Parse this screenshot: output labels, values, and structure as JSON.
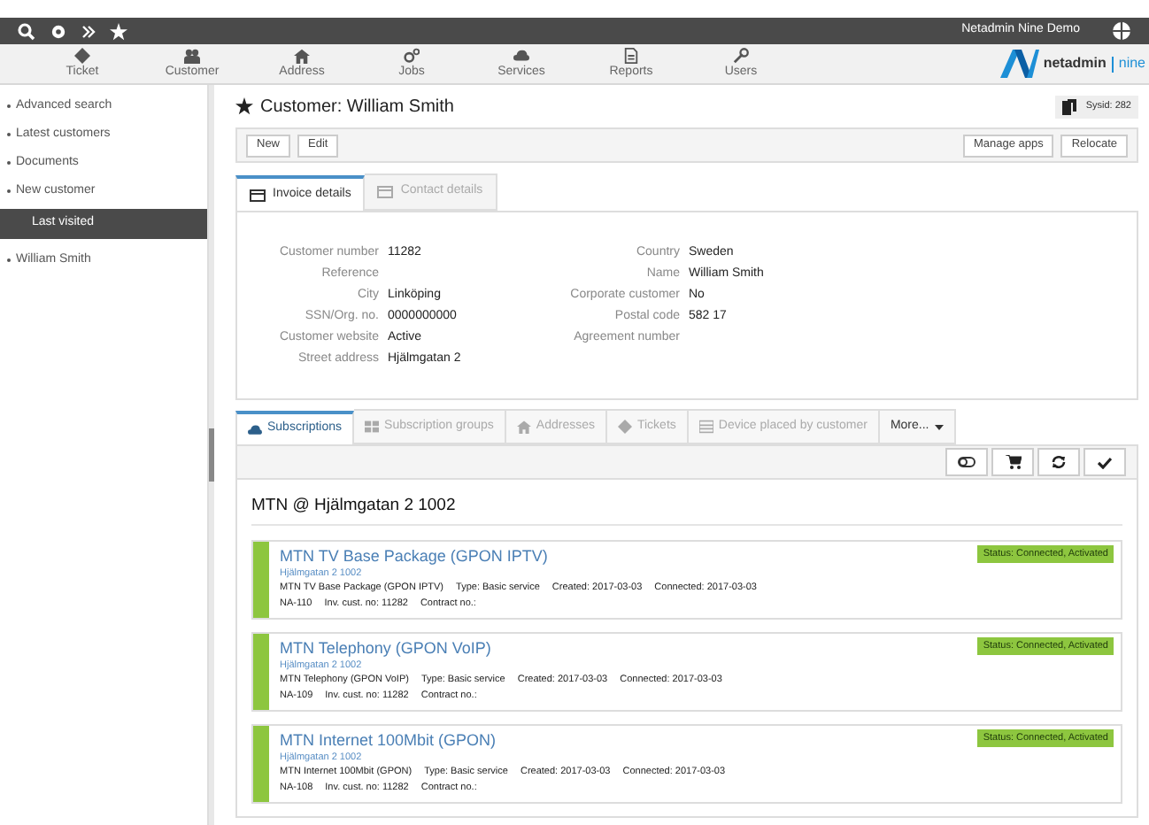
{
  "top_bar": {
    "app_name": "Netadmin Nine Demo"
  },
  "nav": [
    {
      "label": "Ticket",
      "kind": "ticket"
    },
    {
      "label": "Customer",
      "kind": "customer"
    },
    {
      "label": "Address",
      "kind": "address"
    },
    {
      "label": "Jobs",
      "kind": "jobs"
    },
    {
      "label": "Services",
      "kind": "services"
    },
    {
      "label": "Reports",
      "kind": "reports"
    },
    {
      "label": "Users",
      "kind": "users"
    }
  ],
  "logo": {
    "text": "netadmin",
    "suffix": "nine"
  },
  "sidebar": {
    "items": [
      {
        "label": "Advanced search",
        "kind": "link"
      },
      {
        "label": "Latest customers",
        "kind": "link"
      },
      {
        "label": "Documents",
        "kind": "link"
      },
      {
        "label": "New customer",
        "kind": "link"
      },
      {
        "label": "Last visited",
        "kind": "header"
      },
      {
        "label": "William Smith",
        "kind": "link"
      }
    ]
  },
  "page": {
    "title": "Customer: William Smith",
    "sysid": "Sysid: 282"
  },
  "toolbar": {
    "left": [
      "New",
      "Edit"
    ],
    "right": [
      "Manage apps",
      "Relocate"
    ]
  },
  "detail_tabs": [
    {
      "label": "Invoice details",
      "selected": true
    },
    {
      "label": "Contact details",
      "selected": false
    }
  ],
  "fields_left": [
    {
      "label": "Customer number",
      "value": "11282"
    },
    {
      "label": "Reference"
    },
    {
      "label": "City",
      "value": "Linköping"
    },
    {
      "label": "SSN/Org. no.",
      "value": "0000000000"
    },
    {
      "label": "Customer website",
      "value": "Active"
    },
    {
      "label": "Street address",
      "value": "Hjälmgatan 2"
    }
  ],
  "fields_right": [
    {
      "label": "Country",
      "value": "Sweden"
    },
    {
      "label": "Name",
      "value": "William Smith"
    },
    {
      "label": "Corporate customer",
      "value": "No"
    },
    {
      "label": "Postal code",
      "value": "582 17"
    },
    {
      "label": "Agreement number"
    }
  ],
  "sub_tabs": [
    {
      "label": "Subscriptions",
      "selected": true,
      "kind": "cloud"
    },
    {
      "label": "Subscription groups",
      "selected": false,
      "kind": "grid"
    },
    {
      "label": "Addresses",
      "selected": false,
      "kind": "home"
    },
    {
      "label": "Tickets",
      "selected": false,
      "kind": "tag"
    },
    {
      "label": "Device placed by customer",
      "selected": false,
      "kind": "list"
    },
    {
      "label": "More...",
      "selected": false,
      "kind": "more"
    }
  ],
  "section_title": "MTN @ Hjälmgatan 2 1002",
  "subscriptions": [
    {
      "name": "MTN TV Base Package (GPON IPTV)",
      "address": "Hjälmgatan 2 1002",
      "line1": [
        "MTN TV Base Package (GPON IPTV)",
        "Type: Basic service",
        "Created: 2017-03-03",
        "Connected: 2017-03-03"
      ],
      "line2": [
        "NA-110",
        "Inv. cust. no: 11282",
        "Contract no.:"
      ],
      "status": "Status: Connected, Activated",
      "color": "#8dc63f"
    },
    {
      "name": "MTN Telephony (GPON VoIP)",
      "address": "Hjälmgatan 2 1002",
      "line1": [
        "MTN Telephony (GPON VoIP)",
        "Type: Basic service",
        "Created: 2017-03-03",
        "Connected: 2017-03-03"
      ],
      "line2": [
        "NA-109",
        "Inv. cust. no: 11282",
        "Contract no.:"
      ],
      "status": "Status: Connected, Activated",
      "color": "#8dc63f"
    },
    {
      "name": "MTN Internet 100Mbit (GPON)",
      "address": "Hjälmgatan 2 1002",
      "line1": [
        "MTN Internet 100Mbit (GPON)",
        "Type: Basic service",
        "Created: 2017-03-03",
        "Connected: 2017-03-03"
      ],
      "line2": [
        "NA-108",
        "Inv. cust. no: 11282",
        "Contract no.:"
      ],
      "status": "Status: Connected, Activated",
      "color": "#8dc63f"
    }
  ]
}
